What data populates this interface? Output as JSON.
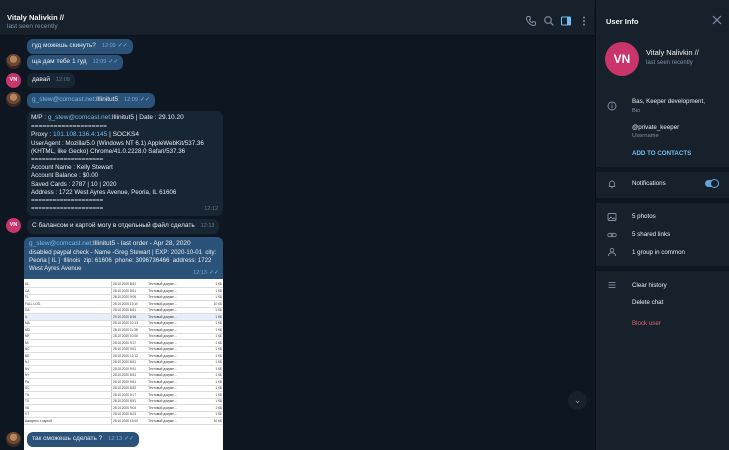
{
  "window": {
    "controls": [
      "—",
      "▢",
      "✕"
    ]
  },
  "header": {
    "name": "Vitaly Nalivkin //",
    "status": "last seen recently"
  },
  "avatars": {
    "initials": "VN"
  },
  "messages": [
    {
      "text": "гуд можешь скинуть?",
      "time": "12:09"
    },
    {
      "text": "ща дам тебе 1 гуд",
      "time": "12:09"
    },
    {
      "text": "давай",
      "time": "12:09"
    },
    {
      "link": "g_stew@comcast.net",
      "rest": ":Illinitut5",
      "time": "12:09"
    },
    {
      "line1_prefix": "M/P : ",
      "line1_link": "g_stew@comcast.net",
      "line1_suffix": ":Illinitut5      | Date : 29.10.20",
      "sep1": "====================",
      "proxy_prefix": "Proxy : ",
      "proxy_link": "101.108.136.4:145",
      "proxy_suffix": " | SOCKS4",
      "body": "UserAgent : Mozilla/5.0 (Windows NT 6.1) AppleWebKit/537.36\n(KHTML, like Gecko) Chrome/41.0.2228.0 Safari/537.36\n====================\nAccount Name : Kelly Stewart\nAccount Balance : $0.00\nSaved Cards : 2787 | 10 | 2020\nAddress : 1722 West Ayres Avenue, Peoria, IL 61606\n====================\n====================",
      "time": "12:12"
    },
    {
      "text": "С балансом и картой могу в отдельный файл сделать",
      "time": "12:13"
    },
    {
      "link": "g_stew@comcast.net",
      "rest": ":Illinitut5 - last order - Apr 28, 2020",
      "body": "disabled paypal check - Name -Greg Stewart | EXP: 2020-10-01  city:\nPeoria [ IL ]  Illinois  zip: 61606  phone: 3096736466  address: 1722\nWest Ayres Avenue",
      "time": "12:13"
    },
    {
      "text": "так сможешь сделать ?",
      "time": "12:13"
    }
  ],
  "document_rows": [
    [
      "AL",
      "28.10.2020 8:51",
      "Тестовый докуме...",
      "1 КБ"
    ],
    [
      "CA",
      "28.10.2020 8:51",
      "Тестовый докуме...",
      "1 КБ"
    ],
    [
      "FL",
      "28.10.2020 9:06",
      "Тестовый докуме...",
      "1 КБ"
    ],
    [
      "FULL LOG",
      "28.10.2020 13:10",
      "Тестовый докуме...",
      "10 КБ"
    ],
    [
      "GA",
      "28.10.2020 8:51",
      "Тестовый докуме...",
      "1 КБ"
    ],
    [
      "IL",
      "29.10.2020 8:36",
      "Тестовый докуме...",
      "1 КБ"
    ],
    [
      "MA",
      "28.10.2020 10:13",
      "Тестовый докуме...",
      "1 КБ"
    ],
    [
      "MD",
      "28.10.2020 11:38",
      "Тестовый докуме...",
      "1 КБ"
    ],
    [
      "MF",
      "28.10.2020 10:06",
      "Тестовый докуме...",
      "1 КБ"
    ],
    [
      "MI",
      "28.10.2020 9:17",
      "Тестовый докуме...",
      "1 КБ"
    ],
    [
      "NC",
      "28.10.2020 9:51",
      "Тестовый докуме...",
      "1 КБ"
    ],
    [
      "NE",
      "28.10.2020 12:12",
      "Тестовый докуме...",
      "1 КБ"
    ],
    [
      "NJ",
      "28.10.2020 8:51",
      "Тестовый докуме...",
      "1 КБ"
    ],
    [
      "NV",
      "28.10.2020 9:51",
      "Тестовый докуме...",
      "1 КБ"
    ],
    [
      "NY",
      "28.10.2020 8:51",
      "Тестовый докуме...",
      "1 КБ"
    ],
    [
      "PA",
      "28.10.2020 9:51",
      "Тестовый докуме...",
      "1 КБ"
    ],
    [
      "SC",
      "28.10.2020 8:52",
      "Тестовый докуме...",
      "1 КБ"
    ],
    [
      "TN",
      "28.10.2020 9:17",
      "Тестовый докуме...",
      "1 КБ"
    ],
    [
      "TX",
      "28.10.2020 8:51",
      "Тестовый докуме...",
      "1 КБ"
    ],
    [
      "VA",
      "28.10.2020 9:04",
      "Тестовый докуме...",
      "1 КБ"
    ],
    [
      "VT",
      "28.10.2020 8:23",
      "Тестовый докуме...",
      "1 КБ"
    ],
    [
      "Аккаунты с картой",
      "28.10.2020 13:00",
      "Тестовый докуме...",
      "10 КБ"
    ]
  ],
  "panel": {
    "title": "User Info",
    "name": "Vitaly Nalivkin //",
    "status": "last seen recently",
    "avatar": "VN",
    "bio": "Bas, Keeper development,",
    "bio_label": "Bio",
    "username": "@private_keeper",
    "username_label": "Username",
    "add_contact": "ADD TO CONTACTS",
    "notifications": "Notifications",
    "notifications_on": true,
    "photos": "5 photos",
    "links": "5 shared links",
    "groups": "1 group in common",
    "clear_history": "Clear history",
    "delete_chat": "Delete chat",
    "block_user": "Block user"
  },
  "colors": {
    "outgoing": "#2b5278",
    "incoming": "#182533",
    "link": "#72bcf3",
    "danger": "#e56767",
    "avatar": "#c9356a"
  }
}
